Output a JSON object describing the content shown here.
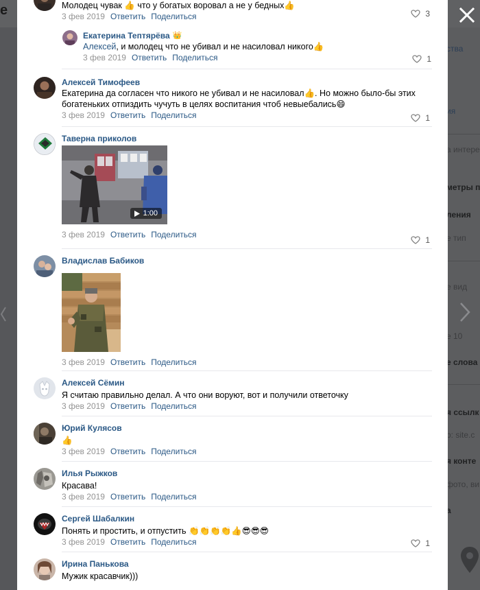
{
  "background": {
    "letter": "е",
    "sidebar_lines": [
      "ства",
      "ия",
      "а интере",
      "метры по",
      "ления",
      "е тип",
      "е вид",
      "е 10",
      "е слова",
      "я ссылк",
      "р: site.c",
      "я конте",
      "фото, ви",
      "а"
    ]
  },
  "comments": [
    {
      "author": "",
      "text": "Молодец чувак 👍 что у богатых воровал а не у бедных👍",
      "date": "3 фев 2019",
      "reply": "Ответить",
      "share": "Поделиться",
      "likes": "3"
    },
    {
      "author": "Екатерина Тептярёва",
      "badge": "👑",
      "mention": "Алексей",
      "text": ", и молодец что не убивал и не насиловал никого👍",
      "date": "3 фев 2019",
      "reply": "Ответить",
      "share": "Поделиться",
      "likes": "1"
    },
    {
      "author": "Алексей Тимофеев",
      "text": "Екатерина да согласен что никого не убивал и не насиловал👍. Но можно было-бы этих богатеньких отпиздить чучуть в целях воспитания чтоб невыебались😄",
      "date": "3 фев 2019",
      "reply": "Ответить",
      "share": "Поделиться",
      "likes": "1"
    },
    {
      "author": "Таверна приколов",
      "video_duration": "1:00",
      "date": "3 фев 2019",
      "reply": "Ответить",
      "share": "Поделиться",
      "likes": "1"
    },
    {
      "author": "Владислав Бабиков",
      "date": "3 фев 2019",
      "reply": "Ответить",
      "share": "Поделиться"
    },
    {
      "author": "Алексей Сёмин",
      "text": "Я считаю правильно делал. А что они воруют, вот и получили ответочку",
      "date": "3 фев 2019",
      "reply": "Ответить",
      "share": "Поделиться"
    },
    {
      "author": "Юрий Кулясов",
      "text": "👍",
      "date": "3 фев 2019",
      "reply": "Ответить",
      "share": "Поделиться"
    },
    {
      "author": "Илья Рыжков",
      "text": "Красава!",
      "date": "3 фев 2019",
      "reply": "Ответить",
      "share": "Поделиться"
    },
    {
      "author": "Сергей Шабалкин",
      "text": "Понять и простить, и отпустить 👏👏👏👏👍😎😎😎",
      "date": "3 фев 2019",
      "reply": "Ответить",
      "share": "Поделиться",
      "likes": "1"
    },
    {
      "author": "Ирина Панькова",
      "text": "Мужик красавчик)))"
    }
  ]
}
